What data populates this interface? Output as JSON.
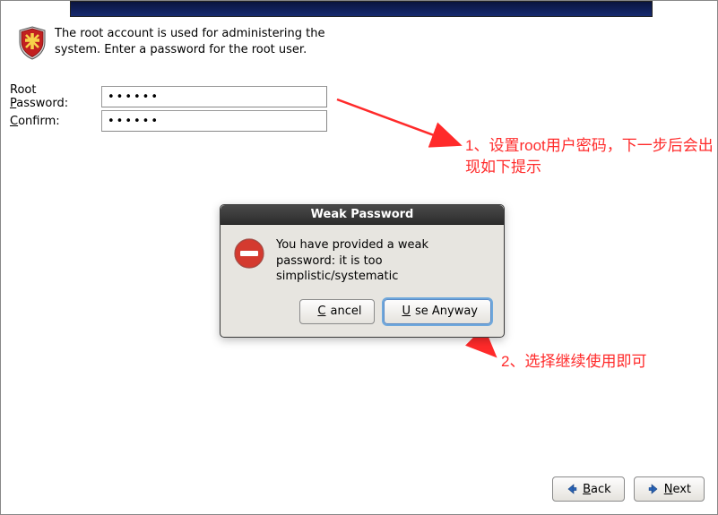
{
  "description": "The root account is used for administering the system.  Enter a password for the root user.",
  "fields": {
    "root_password": {
      "label_pre": "Root ",
      "label_u": "P",
      "label_post": "assword:",
      "value": "••••••"
    },
    "confirm": {
      "label_pre": "",
      "label_u": "C",
      "label_post": "onfirm:",
      "value": "••••••"
    }
  },
  "dialog": {
    "title": "Weak Password",
    "message": "You have provided a weak password: it is too simplistic/systematic",
    "cancel_pre": "",
    "cancel_u": "C",
    "cancel_post": "ancel",
    "use_pre": "",
    "use_u": "U",
    "use_post": "se Anyway"
  },
  "nav": {
    "back_u": "B",
    "back_post": "ack",
    "next_u": "N",
    "next_post": "ext"
  },
  "annotations": {
    "a1": "1、设置root用户密码，下一步后会出现如下提示",
    "a2": "2、选择继续使用即可"
  },
  "colors": {
    "anno": "#ff2a2a"
  }
}
